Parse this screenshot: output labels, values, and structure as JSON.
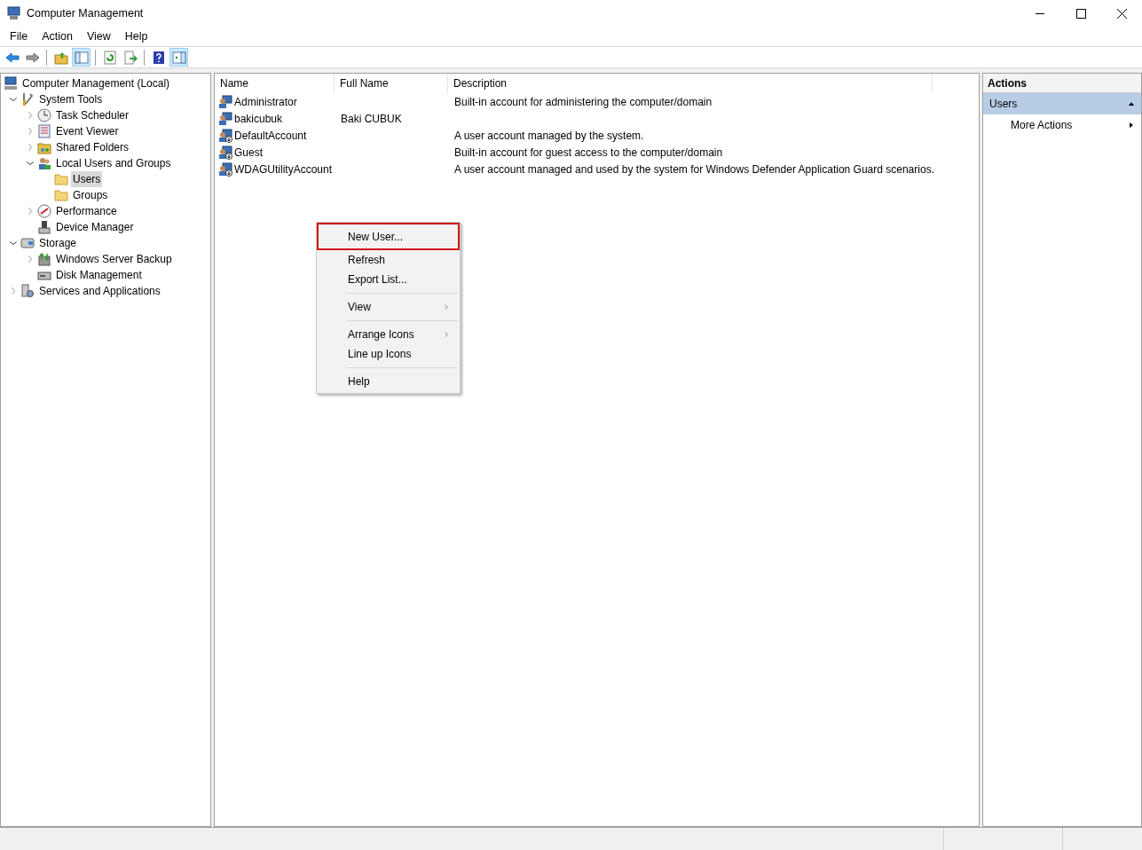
{
  "window": {
    "title": "Computer Management"
  },
  "menu": [
    "File",
    "Action",
    "View",
    "Help"
  ],
  "toolbar": [
    {
      "kind": "back",
      "pressed": false
    },
    {
      "kind": "forward",
      "pressed": false
    },
    {
      "kind": "sep"
    },
    {
      "kind": "up",
      "pressed": false
    },
    {
      "kind": "tree",
      "pressed": true
    },
    {
      "kind": "sep"
    },
    {
      "kind": "refresh",
      "pressed": false
    },
    {
      "kind": "export",
      "pressed": false
    },
    {
      "kind": "sep"
    },
    {
      "kind": "help",
      "pressed": false
    },
    {
      "kind": "pane",
      "pressed": true
    }
  ],
  "tree": [
    {
      "label": "Computer Management (Local)",
      "kind": "computer",
      "selected": false,
      "children": [
        {
          "label": "System Tools",
          "kind": "tools",
          "expanded": true,
          "selected": false,
          "children": [
            {
              "label": "Task Scheduler",
              "kind": "clock",
              "expanded": false,
              "selected": false
            },
            {
              "label": "Event Viewer",
              "kind": "log",
              "expanded": false,
              "selected": false
            },
            {
              "label": "Shared Folders",
              "kind": "share",
              "expanded": false,
              "selected": false
            },
            {
              "label": "Local Users and Groups",
              "kind": "users",
              "expanded": true,
              "selected": false,
              "children": [
                {
                  "label": "Users",
                  "kind": "folder",
                  "selected": true
                },
                {
                  "label": "Groups",
                  "kind": "folder",
                  "selected": false
                }
              ]
            },
            {
              "label": "Performance",
              "kind": "perf",
              "expanded": false,
              "selected": false
            },
            {
              "label": "Device Manager",
              "kind": "device",
              "selected": false
            }
          ]
        },
        {
          "label": "Storage",
          "kind": "storage",
          "expanded": true,
          "selected": false,
          "children": [
            {
              "label": "Windows Server Backup",
              "kind": "backup",
              "expanded": false,
              "selected": false
            },
            {
              "label": "Disk Management",
              "kind": "disk",
              "selected": false
            }
          ]
        },
        {
          "label": "Services and Applications",
          "kind": "services",
          "expanded": false,
          "selected": false
        }
      ]
    }
  ],
  "table": {
    "columns": [
      "Name",
      "Full Name",
      "Description"
    ],
    "rows": [
      {
        "name": "Administrator",
        "full_name": "",
        "description": "Built-in account for administering the computer/domain",
        "disabled": false
      },
      {
        "name": "bakicubuk",
        "full_name": "Baki CUBUK",
        "description": "",
        "disabled": false
      },
      {
        "name": "DefaultAccount",
        "full_name": "",
        "description": "A user account managed by the system.",
        "disabled": true
      },
      {
        "name": "Guest",
        "full_name": "",
        "description": "Built-in account for guest access to the computer/domain",
        "disabled": true
      },
      {
        "name": "WDAGUtilityAccount",
        "full_name": "",
        "description": "A user account managed and used by the system for Windows Defender Application Guard scenarios.",
        "disabled": true
      }
    ]
  },
  "context_menu": [
    {
      "kind": "item",
      "label": "New User...",
      "submenu": false,
      "highlighted": true
    },
    {
      "kind": "item",
      "label": "Refresh",
      "submenu": false,
      "highlighted": false
    },
    {
      "kind": "item",
      "label": "Export List...",
      "submenu": false,
      "highlighted": false
    },
    {
      "kind": "separator"
    },
    {
      "kind": "item",
      "label": "View",
      "submenu": true,
      "highlighted": false
    },
    {
      "kind": "separator"
    },
    {
      "kind": "item",
      "label": "Arrange Icons",
      "submenu": true,
      "highlighted": false
    },
    {
      "kind": "item",
      "label": "Line up Icons",
      "submenu": false,
      "highlighted": false
    },
    {
      "kind": "separator"
    },
    {
      "kind": "item",
      "label": "Help",
      "submenu": false,
      "highlighted": false
    }
  ],
  "actions": {
    "title": "Actions",
    "section": "Users",
    "items": [
      "More Actions"
    ]
  }
}
